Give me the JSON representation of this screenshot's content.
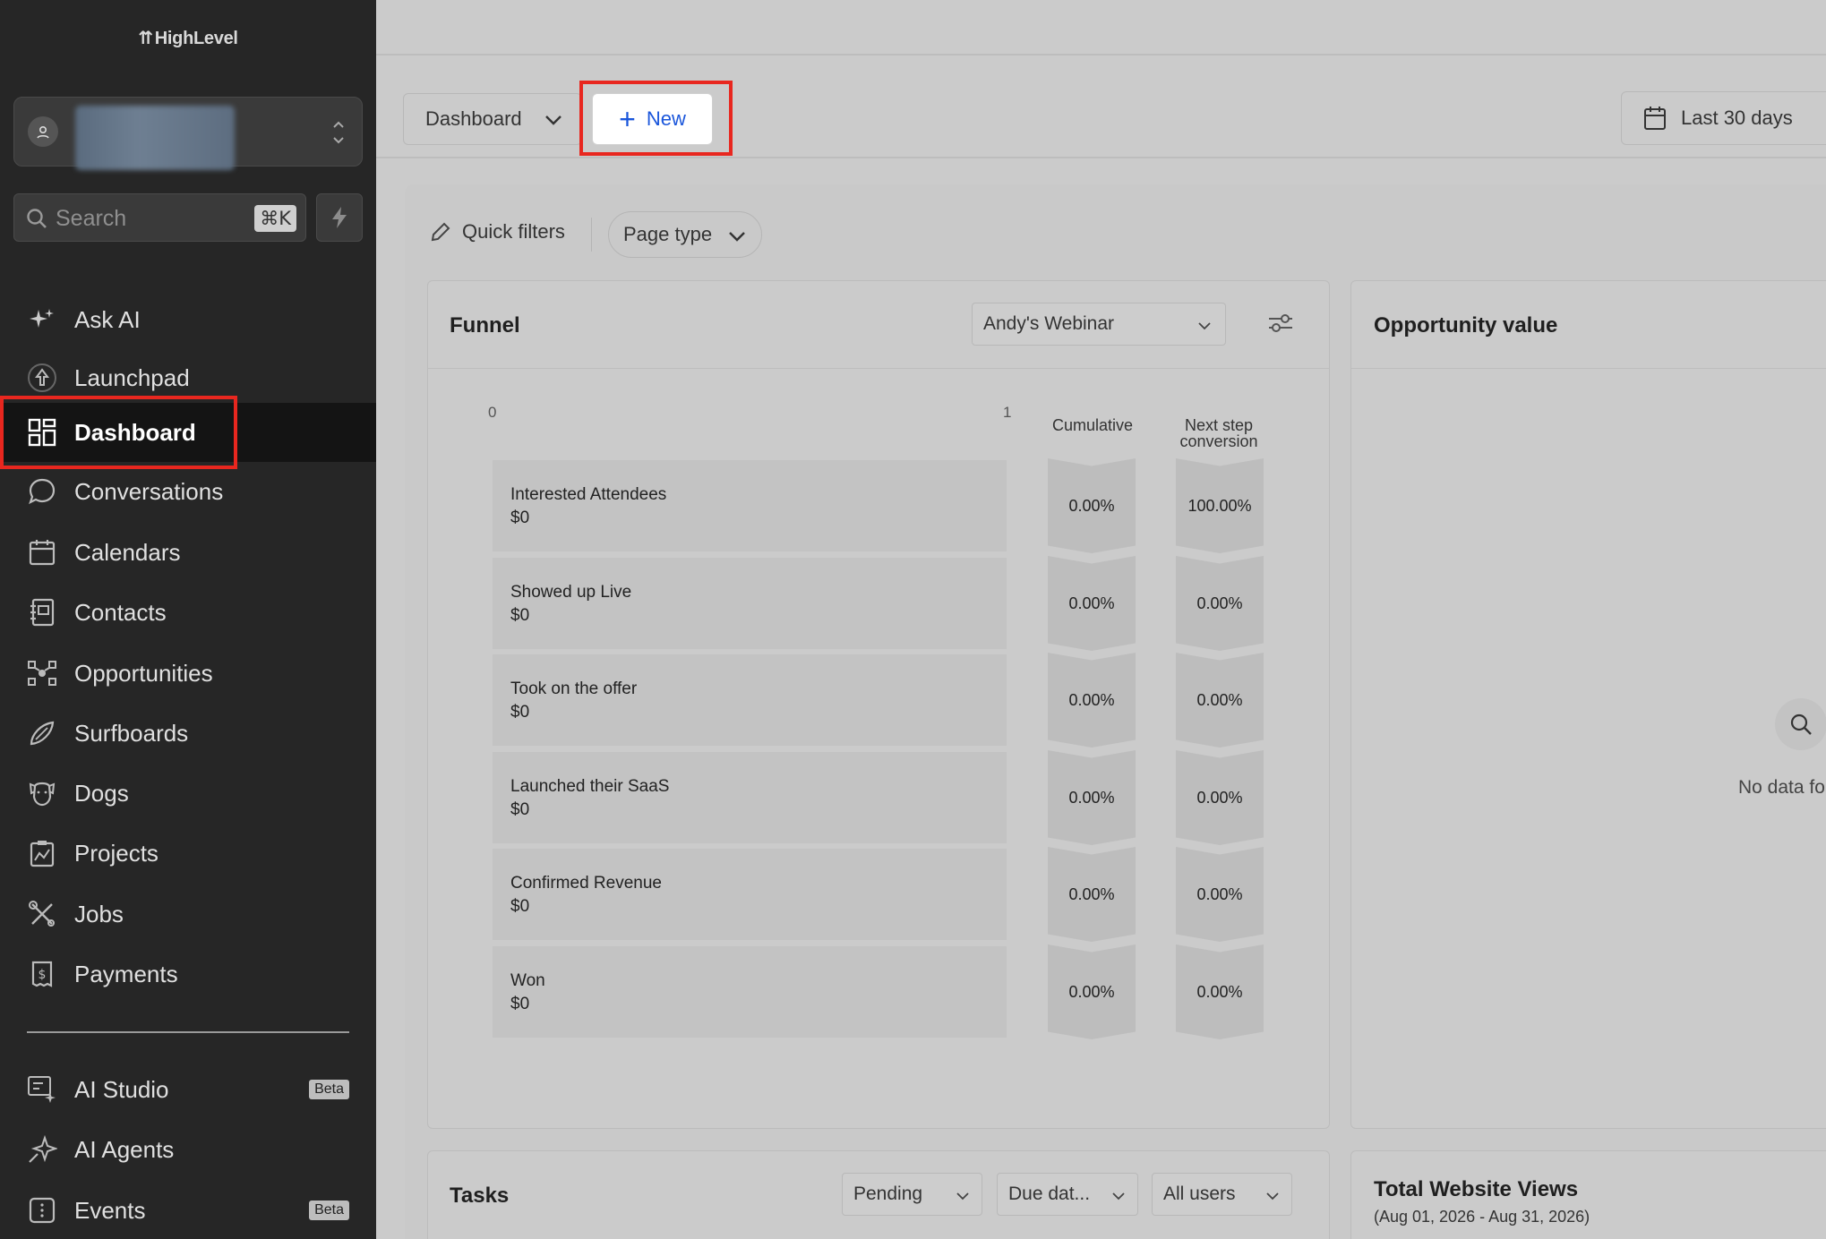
{
  "sidebar": {
    "logo": "HighLevel",
    "search": {
      "placeholder": "Search",
      "shortcut": "⌘K"
    },
    "items": [
      {
        "label": "Ask AI",
        "icon": "sparkles-icon"
      },
      {
        "label": "Launchpad",
        "icon": "rocket-icon"
      },
      {
        "label": "Dashboard",
        "icon": "dashboard-grid-icon",
        "active": true
      },
      {
        "label": "Conversations",
        "icon": "chat-bubble-icon"
      },
      {
        "label": "Calendars",
        "icon": "calendar-icon"
      },
      {
        "label": "Contacts",
        "icon": "contact-book-icon"
      },
      {
        "label": "Opportunities",
        "icon": "opportunities-icon"
      },
      {
        "label": "Surfboards",
        "icon": "surfboard-icon"
      },
      {
        "label": "Dogs",
        "icon": "dog-icon"
      },
      {
        "label": "Projects",
        "icon": "chart-clipboard-icon"
      },
      {
        "label": "Jobs",
        "icon": "tools-icon"
      },
      {
        "label": "Payments",
        "icon": "receipt-dollar-icon"
      }
    ],
    "bottom_items": [
      {
        "label": "AI Studio",
        "badge": "Beta",
        "icon": "ai-studio-icon"
      },
      {
        "label": "AI Agents",
        "icon": "ai-agents-icon"
      },
      {
        "label": "Events",
        "badge": "Beta",
        "icon": "events-icon"
      }
    ]
  },
  "toolbar": {
    "dashboard_label": "Dashboard",
    "new_label": "New",
    "date_range": "Last 30 days"
  },
  "filters": {
    "quick_filters": "Quick filters",
    "page_type": "Page type"
  },
  "funnel": {
    "title": "Funnel",
    "selected": "Andy's Webinar",
    "axis_min": "0",
    "axis_max": "1",
    "col_cumulative": "Cumulative",
    "col_next_line1": "Next step",
    "col_next_line2": "conversion",
    "stages": [
      {
        "name": "Interested Attendees",
        "value": "$0",
        "cumulative": "0.00%",
        "next": "100.00%"
      },
      {
        "name": "Showed up Live",
        "value": "$0",
        "cumulative": "0.00%",
        "next": "0.00%"
      },
      {
        "name": "Took on the offer",
        "value": "$0",
        "cumulative": "0.00%",
        "next": "0.00%"
      },
      {
        "name": "Launched their SaaS",
        "value": "$0",
        "cumulative": "0.00%",
        "next": "0.00%"
      },
      {
        "name": "Confirmed Revenue",
        "value": "$0",
        "cumulative": "0.00%",
        "next": "0.00%"
      },
      {
        "name": "Won",
        "value": "$0",
        "cumulative": "0.00%",
        "next": "0.00%"
      }
    ]
  },
  "opportunity": {
    "title": "Opportunity value",
    "no_data": "No data fo"
  },
  "tasks": {
    "title": "Tasks",
    "status": "Pending",
    "sort": "Due dat...",
    "users": "All users"
  },
  "website_views": {
    "title": "Total Website Views",
    "range": "(Aug 01, 2026 - Aug 31, 2026)"
  },
  "colors": {
    "accent": "#1a56db",
    "highlight": "#e8271f",
    "sidebar_bg": "#262626"
  }
}
